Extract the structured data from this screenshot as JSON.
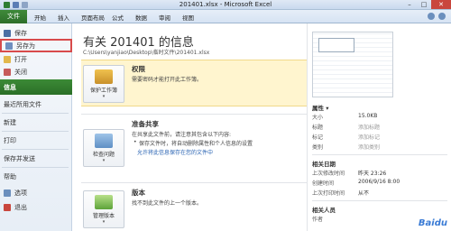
{
  "window": {
    "title": "201401.xlsx - Microsoft Excel",
    "controls": {
      "minimize": "–",
      "maximize": "□",
      "close": "✕"
    }
  },
  "ribbon": {
    "file_tab": "文件",
    "tabs": [
      "开始",
      "插入",
      "页面布局",
      "公式",
      "数据",
      "审阅",
      "视图"
    ]
  },
  "left_nav": {
    "items": [
      {
        "label": "保存",
        "icon": "save-icon"
      },
      {
        "label": "另存为",
        "icon": "saveas-icon"
      },
      {
        "label": "打开",
        "icon": "open-icon"
      },
      {
        "label": "关闭",
        "icon": "close-file-icon"
      },
      {
        "label": "信息"
      },
      {
        "label": "最近所用文件"
      },
      {
        "label": "新建"
      },
      {
        "label": "打印"
      },
      {
        "label": "保存并发送"
      },
      {
        "label": "帮助"
      },
      {
        "label": "选项",
        "icon": "options-icon"
      },
      {
        "label": "退出",
        "icon": "exit-icon"
      }
    ],
    "active_index": 4,
    "accent": "#2e7d32"
  },
  "main": {
    "title": "有关 201401 的信息",
    "path": "C:\\Users\\yanjiao\\Desktop\\临时文件\\201401.xlsx",
    "permissions": {
      "button_label": "保护工作簿",
      "button_arrow": "▾",
      "title": "权限",
      "line1": "需要密码才能打开此工作簿。"
    },
    "prepare_share": {
      "button_label": "检查问题",
      "button_arrow": "▾",
      "title": "准备共享",
      "line1": "在共享此文件前，请注意其包含以下内容:",
      "bullet1": "保存文件时，将自动删除属性和个人信息的设置",
      "link": "允许将此信息保存在您的文件中"
    },
    "versions": {
      "button_label": "管理版本",
      "button_arrow": "▾",
      "title": "版本",
      "line1": "找不到此文件的上一个版本。"
    }
  },
  "right_pane": {
    "properties_header": "属性 ▾",
    "properties": [
      {
        "label": "大小",
        "value": "15.0KB",
        "placeholder": false
      },
      {
        "label": "标题",
        "value": "添加标题",
        "placeholder": true
      },
      {
        "label": "标记",
        "value": "添加标记",
        "placeholder": true
      },
      {
        "label": "类别",
        "value": "添加类别",
        "placeholder": true
      }
    ],
    "dates_header": "相关日期",
    "dates": [
      {
        "label": "上次修改时间",
        "value": "昨天 23:26"
      },
      {
        "label": "创建时间",
        "value": "2006/9/16 8:00"
      },
      {
        "label": "上次打印时间",
        "value": "从不"
      }
    ],
    "people_header": "相关人员",
    "people": [
      {
        "label": "作者",
        "value": ""
      }
    ]
  },
  "watermark": "Baidu"
}
